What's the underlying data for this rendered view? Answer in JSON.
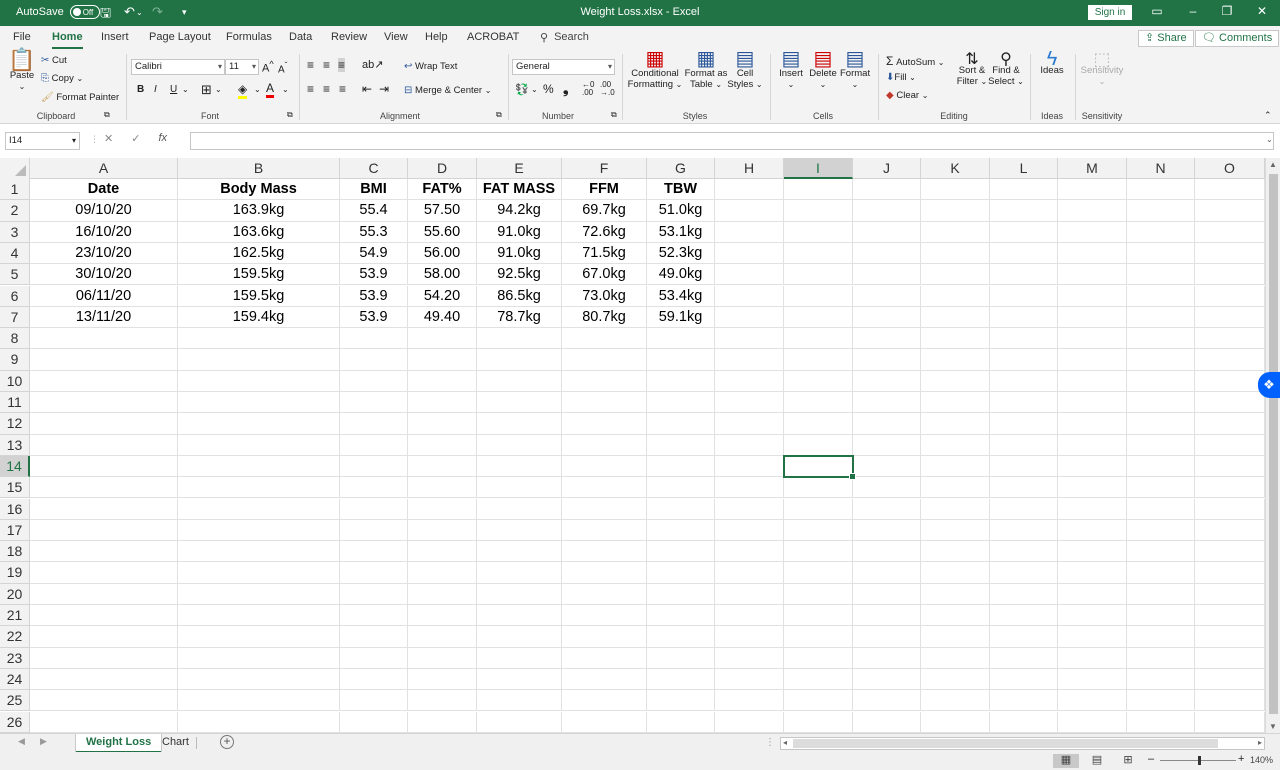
{
  "window": {
    "autosave_label": "AutoSave",
    "autosave_state": "Off",
    "title": "Weight Loss.xlsx  -  Excel",
    "signin_label": "Sign in"
  },
  "tabs": [
    "File",
    "Home",
    "Insert",
    "Page Layout",
    "Formulas",
    "Data",
    "Review",
    "View",
    "Help",
    "ACROBAT"
  ],
  "active_tab": "Home",
  "search_label": "Search",
  "share_label": "Share",
  "comments_label": "Comments",
  "ribbon": {
    "clipboard": {
      "paste": "Paste",
      "cut": "Cut",
      "copy": "Copy",
      "format_painter": "Format Painter",
      "label": "Clipboard"
    },
    "font": {
      "name": "Calibri",
      "size": "11",
      "label": "Font",
      "bold": "B",
      "italic": "I",
      "underline": "U"
    },
    "alignment": {
      "wrap_text": "Wrap Text",
      "merge_center": "Merge & Center",
      "label": "Alignment"
    },
    "number": {
      "format": "General",
      "label": "Number",
      "percent": "%",
      "comma": "❟",
      "inc_dec": ".00",
      "dec_dec": ".0"
    },
    "styles": {
      "conditional_1": "Conditional",
      "conditional_2": "Formatting",
      "format_as_1": "Format as",
      "format_as_2": "Table",
      "cell_styles_1": "Cell",
      "cell_styles_2": "Styles",
      "label": "Styles"
    },
    "cells": {
      "insert": "Insert",
      "delete": "Delete",
      "format": "Format",
      "label": "Cells"
    },
    "editing": {
      "autosum": "AutoSum",
      "fill": "Fill",
      "clear": "Clear",
      "sort_1": "Sort &",
      "sort_2": "Filter",
      "find_1": "Find &",
      "find_2": "Select",
      "label": "Editing"
    },
    "ideas": {
      "ideas": "Ideas",
      "label": "Ideas"
    },
    "sensitivity": {
      "sensitivity": "Sensitivity",
      "label": "Sensitivity"
    }
  },
  "name_box": "I14",
  "fx_label": "fx",
  "columns": [
    "A",
    "B",
    "C",
    "D",
    "E",
    "F",
    "G",
    "H",
    "I",
    "J",
    "K",
    "L",
    "M",
    "N",
    "O"
  ],
  "selected_column": "I",
  "selected_row": "14",
  "row_numbers": [
    "1",
    "2",
    "3",
    "4",
    "5",
    "6",
    "7",
    "8",
    "9",
    "10",
    "11",
    "12",
    "13",
    "14",
    "15",
    "16",
    "17",
    "18",
    "19",
    "20",
    "21",
    "22",
    "23",
    "24",
    "25",
    "26"
  ],
  "table": {
    "headers": [
      "Date",
      "Body Mass",
      "BMI",
      "FAT%",
      "FAT MASS",
      "FFM",
      "TBW"
    ],
    "rows": [
      [
        "09/10/20",
        "163.9kg",
        "55.4",
        "57.50",
        "94.2kg",
        "69.7kg",
        "51.0kg"
      ],
      [
        "16/10/20",
        "163.6kg",
        "55.3",
        "55.60",
        "91.0kg",
        "72.6kg",
        "53.1kg"
      ],
      [
        "23/10/20",
        "162.5kg",
        "54.9",
        "56.00",
        "91.0kg",
        "71.5kg",
        "52.3kg"
      ],
      [
        "30/10/20",
        "159.5kg",
        "53.9",
        "58.00",
        "92.5kg",
        "67.0kg",
        "49.0kg"
      ],
      [
        "06/11/20",
        "159.5kg",
        "53.9",
        "54.20",
        "86.5kg",
        "73.0kg",
        "53.4kg"
      ],
      [
        "13/11/20",
        "159.4kg",
        "53.9",
        "49.40",
        "78.7kg",
        "80.7kg",
        "59.1kg"
      ]
    ]
  },
  "sheets": [
    "Weight Loss",
    "Chart"
  ],
  "active_sheet": "Weight Loss",
  "zoom": "140%",
  "colors": {
    "accent": "#217346",
    "dropbox": "#0061fe"
  }
}
